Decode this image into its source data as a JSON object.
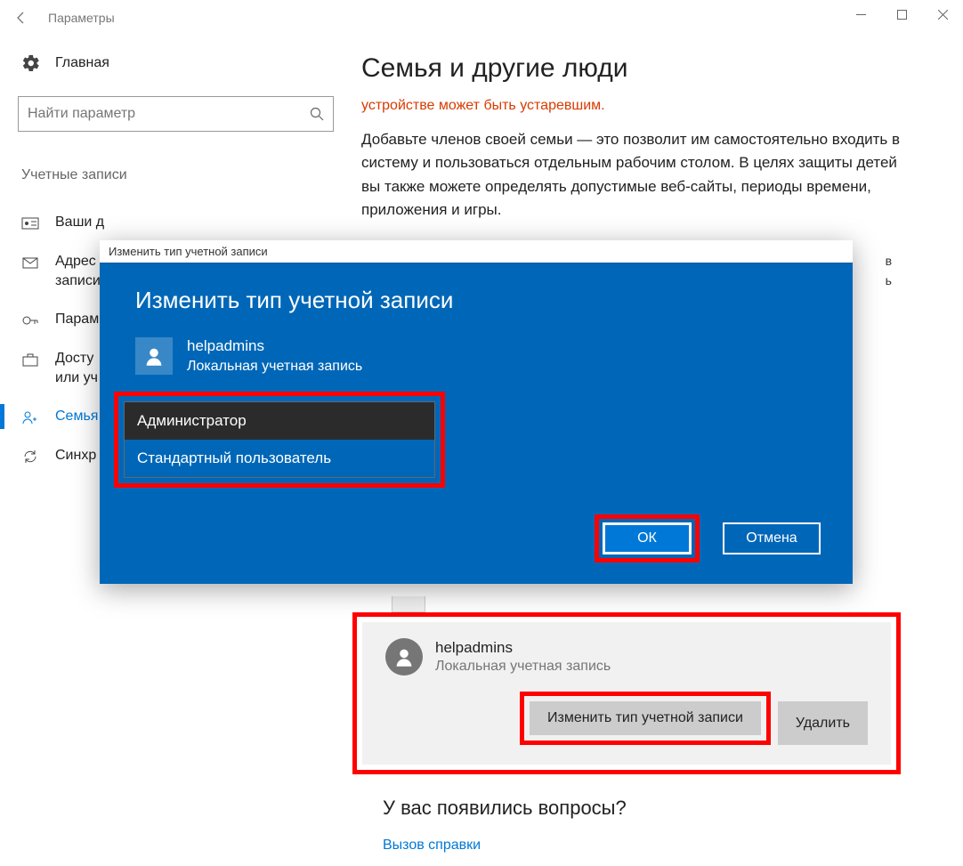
{
  "window": {
    "title": "Параметры"
  },
  "sidebar": {
    "home": "Главная",
    "search_placeholder": "Найти параметр",
    "category": "Учетные записи",
    "items": [
      {
        "label": "Ваши д"
      },
      {
        "label": "Адрес\nзаписи"
      },
      {
        "label": "Парам"
      },
      {
        "label": "Досту\nили уч"
      },
      {
        "label": "Семья"
      },
      {
        "label": "Синхр"
      }
    ]
  },
  "content": {
    "heading": "Семья и другие люди",
    "warning": "устройстве может быть устаревшим.",
    "paragraph": "Добавьте членов своей семьи — это позволит им самостоятельно входить в систему и пользоваться отдельным рабочим столом. В целях защиты детей вы также можете определять допустимые веб-сайты, периоды времени, приложения и игры.",
    "edge_text_1": "в",
    "edge_text_2": "ь"
  },
  "dialog": {
    "titlebar": "Изменить тип учетной записи",
    "heading": "Изменить тип учетной записи",
    "user_name": "helpadmins",
    "user_type": "Локальная учетная запись",
    "options": [
      {
        "label": "Администратор"
      },
      {
        "label": "Стандартный пользователь"
      }
    ],
    "ok": "ОК",
    "cancel": "Отмена"
  },
  "user_card": {
    "name": "helpadmins",
    "subtitle": "Локальная учетная запись",
    "change_btn": "Изменить тип учетной записи",
    "delete_btn": "Удалить"
  },
  "footer": {
    "question": "У вас появились вопросы?",
    "help_link": "Вызов справки"
  }
}
